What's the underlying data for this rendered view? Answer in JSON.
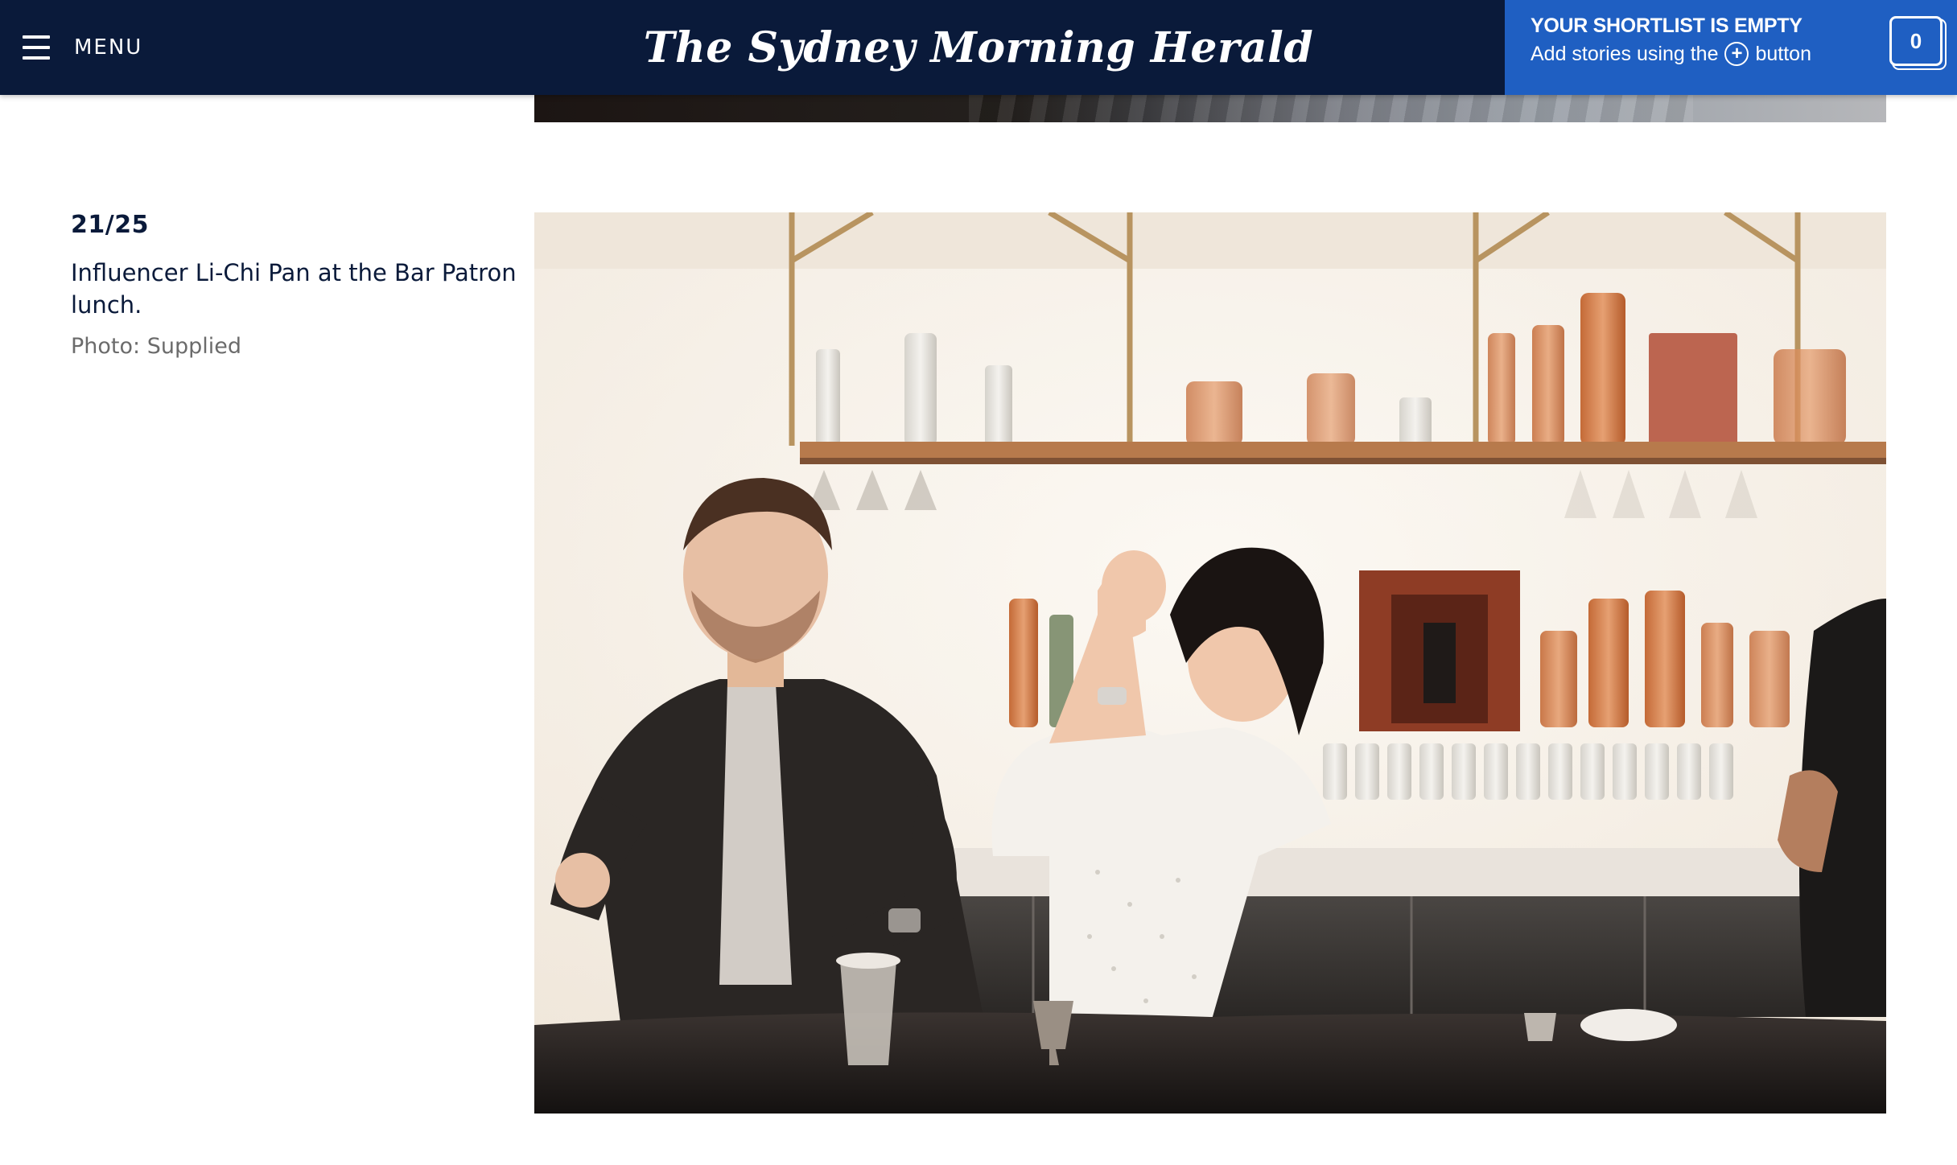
{
  "header": {
    "menu_label": "MENU",
    "masthead": "The Sydney Morning Herald",
    "background": "#0a1a3a"
  },
  "shortlist": {
    "title": "YOUR SHORTLIST IS EMPTY",
    "sub_before": "Add stories using the",
    "sub_icon": "+",
    "sub_after": "button",
    "count": "0",
    "accent": "#1f5fc2"
  },
  "gallery": {
    "counter": "21/25",
    "caption": "Influencer Li-Chi Pan at the Bar Patron lunch.",
    "credit": "Photo: Supplied"
  }
}
